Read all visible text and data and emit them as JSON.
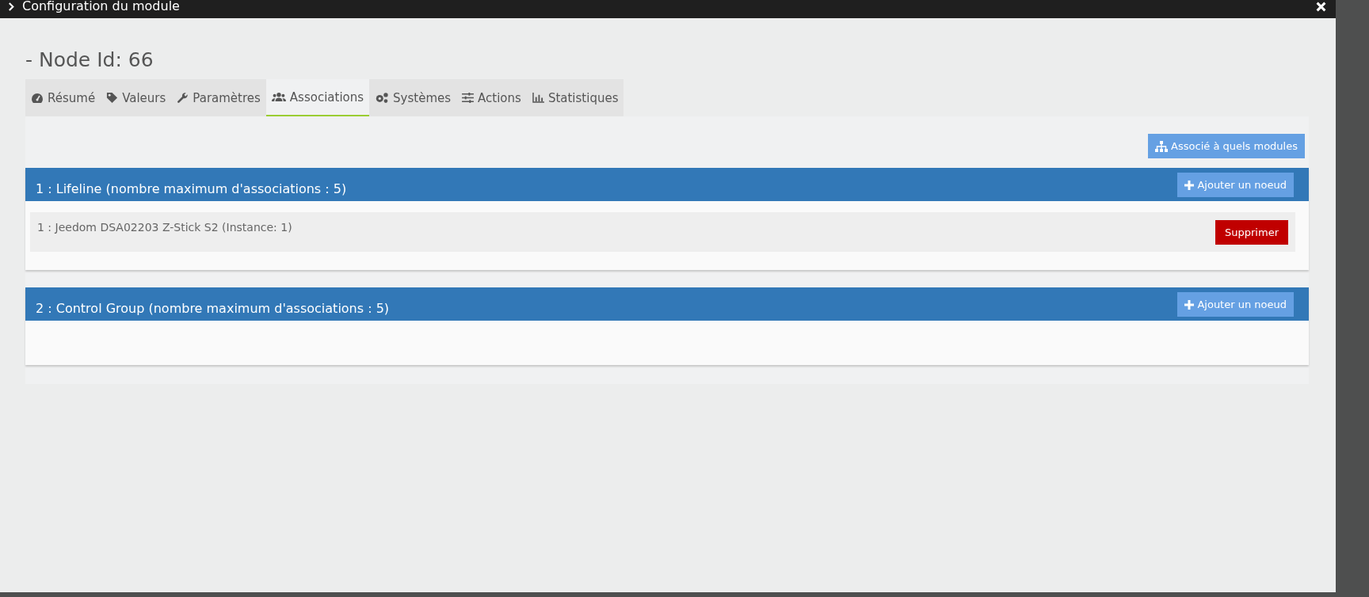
{
  "window": {
    "title": "Configuration du module"
  },
  "heading": "- Node Id: 66",
  "tabs": [
    {
      "label": "Résumé",
      "kind": "gauge",
      "selected": false
    },
    {
      "label": "Valeurs",
      "kind": "tag",
      "selected": false
    },
    {
      "label": "Paramètres",
      "kind": "wrench",
      "selected": false
    },
    {
      "label": "Associations",
      "kind": "users",
      "selected": true
    },
    {
      "label": "Systèmes",
      "kind": "gears",
      "selected": false
    },
    {
      "label": "Actions",
      "kind": "sliders",
      "selected": false
    },
    {
      "label": "Statistiques",
      "kind": "chart",
      "selected": false
    }
  ],
  "associated_button": "Associé à quels modules",
  "groups": [
    {
      "title": "1 : Lifeline (nombre maximum d'associations : 5)",
      "add_button": "Ajouter un noeud",
      "nodes": [
        {
          "label": "1 : Jeedom DSA02203 Z-Stick S2 (Instance: 1)",
          "delete_button": "Supprimer"
        }
      ]
    },
    {
      "title": "2 : Control Group (nombre maximum d'associations : 5)",
      "add_button": "Ajouter un noeud"
    }
  ]
}
